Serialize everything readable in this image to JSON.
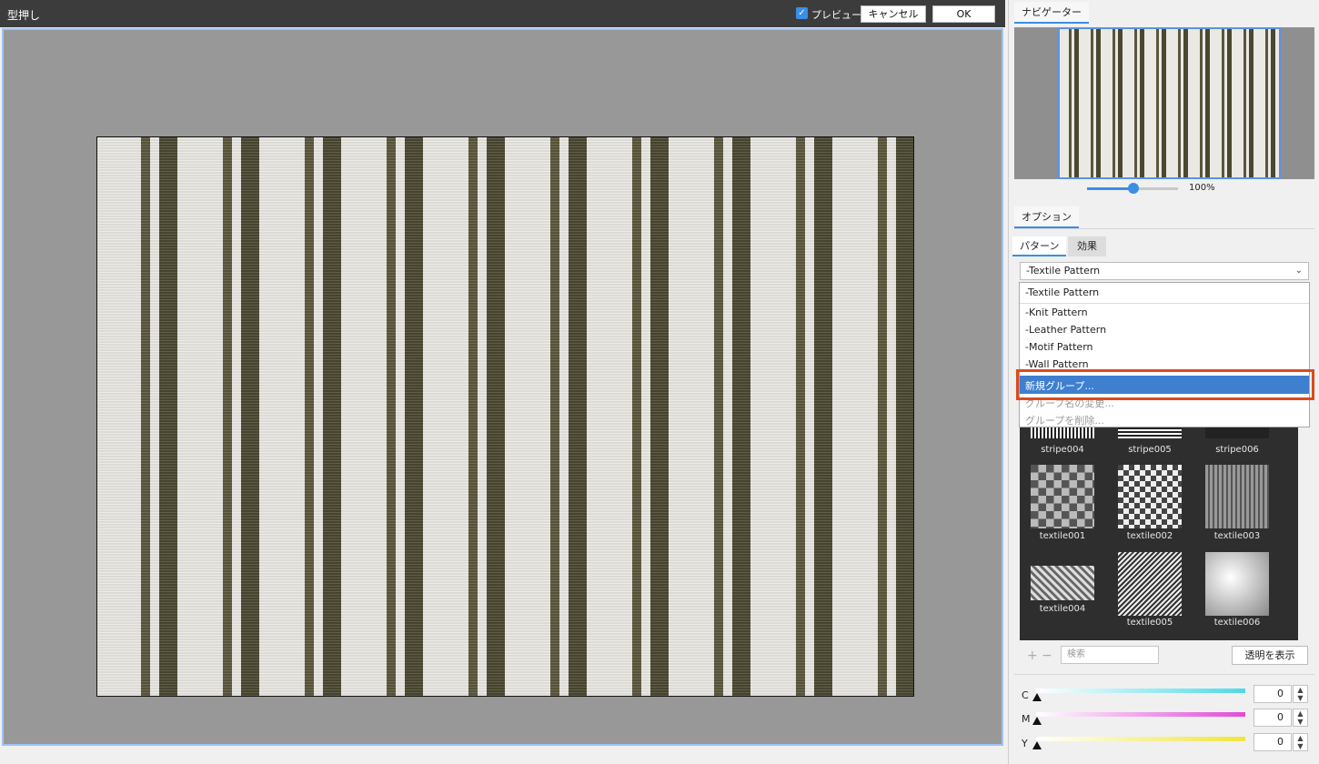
{
  "window": {
    "title": "型押し",
    "preview_label": "プレビュー",
    "preview_checked": true,
    "cancel_label": "キャンセル",
    "ok_label": "OK"
  },
  "navigator": {
    "tab_label": "ナビゲーター",
    "zoom_value": "100%"
  },
  "options": {
    "tab_label": "オプション",
    "subtabs": [
      "パターン",
      "効果"
    ],
    "group_selected": "-Textile Pattern",
    "dropdown_items": [
      "-Textile Pattern",
      "-Knit Pattern",
      "-Leather Pattern",
      "-Motif Pattern",
      "-Wall Pattern",
      "新規グループ...",
      "グループ名の変更...",
      "グループを削除..."
    ],
    "highlighted_item": "新規グループ...",
    "thumbnails": [
      "stripe004",
      "stripe005",
      "stripe006",
      "textile001",
      "textile002",
      "textile003",
      "textile004",
      "textile005",
      "textile006"
    ],
    "search_placeholder": "検索",
    "show_transparent_label": "透明を表示"
  },
  "color": {
    "c_label": "C",
    "c_value": "0",
    "m_label": "M",
    "m_value": "0",
    "y_label": "Y",
    "y_value": "0",
    "c_color": "#4fd9e6",
    "m_color": "#e24ad8",
    "y_color": "#f0e63a"
  },
  "colors": {
    "accent": "#3a8ee6",
    "highlight": "#3e7fd0",
    "annotation_box": "#dd4a1e"
  }
}
